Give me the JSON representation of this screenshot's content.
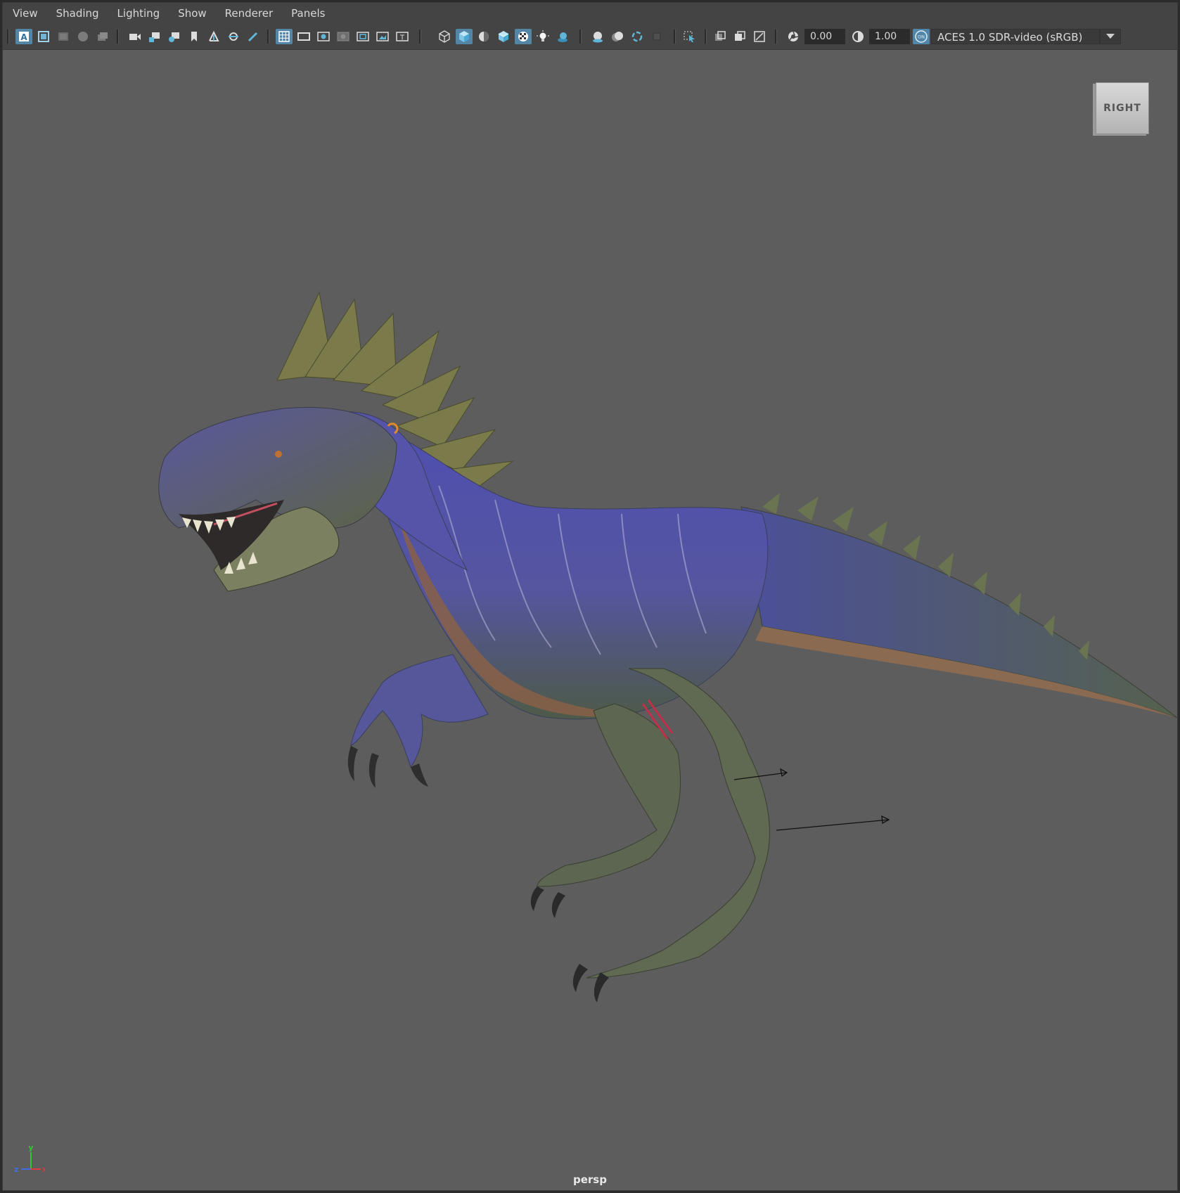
{
  "menu": {
    "view": "View",
    "shading": "Shading",
    "lighting": "Lighting",
    "show": "Show",
    "renderer": "Renderer",
    "panels": "Panels"
  },
  "toolbar": {
    "exposure_value": "0.00",
    "gamma_value": "1.00",
    "colorspace_label": "ACES 1.0 SDR-video (sRGB)",
    "color_management_state": "ON"
  },
  "viewport": {
    "viewcube_label": "RIGHT",
    "camera_name": "persp",
    "background_color": "#5d5d5d"
  },
  "axis": {
    "x": "x",
    "y": "y",
    "z": "z"
  },
  "colors": {
    "accent": "#5285a6",
    "axis_x": "#e03a3a",
    "axis_y": "#35c435",
    "axis_z": "#3f6fe0"
  }
}
